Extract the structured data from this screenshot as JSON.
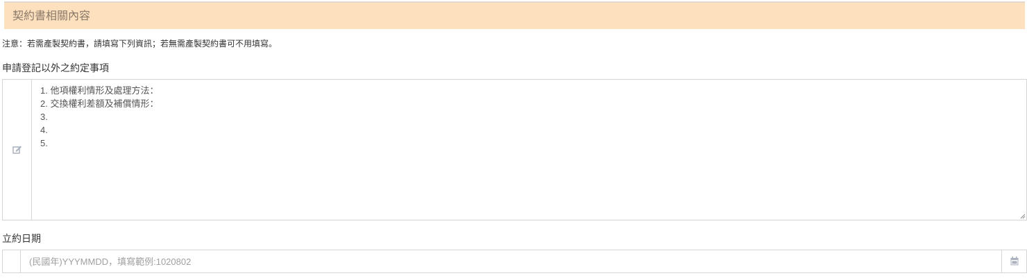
{
  "section": {
    "title": "契約書相關內容"
  },
  "notice": "注意：若需產製契約書，請填寫下列資訊；若無需產製契約書可不用填寫。",
  "terms_field": {
    "label": "申請登記以外之約定事項",
    "icon": "edit-icon",
    "lines": [
      "1. 他項權利情形及處理方法：",
      "2. 交換權利差額及補償情形：",
      "3.",
      "4.",
      "5."
    ]
  },
  "date_field": {
    "label": "立約日期",
    "placeholder": "(民國年)YYYMMDD，填寫範例:1020802",
    "icon": "calendar-icon"
  },
  "colors": {
    "header_bg": "#fde0bd",
    "header_text": "#8a7a6a",
    "border": "#d5d5d5",
    "icon": "#aab2bd"
  }
}
